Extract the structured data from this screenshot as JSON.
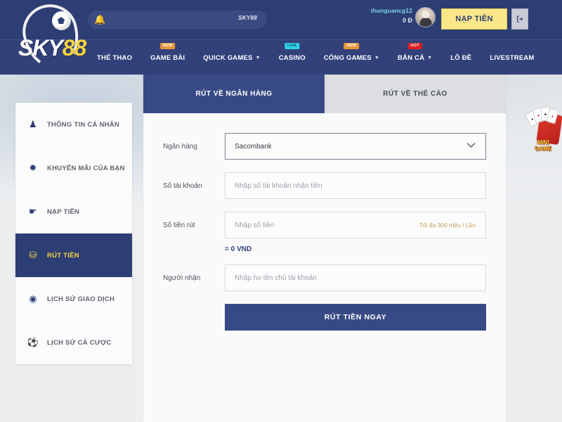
{
  "brand": {
    "logo_primary": "SKY",
    "logo_accent": "88",
    "logo_ball_icon": "soccer-ball-icon"
  },
  "topbar": {
    "marquee": {
      "icon": "bell-notification-icon",
      "text": "SKY88"
    },
    "user": {
      "username": "thunguancg12",
      "balance": "0 Ð",
      "avatar_icon": "user-avatar-icon"
    },
    "deposit_label": "NẠP TIỀN",
    "logout_icon": "logout-icon",
    "colors": {
      "header_bg": "#2c3e73",
      "nav_bg": "#33417a",
      "deposit_bg": "#fbe78a",
      "accent_gold": "#f5d340"
    }
  },
  "nav": {
    "items": [
      {
        "label": "THỂ THAO",
        "badge": null,
        "badge_type": null,
        "caret": false
      },
      {
        "label": "GAME BÀI",
        "badge": "NEW",
        "badge_type": "new",
        "caret": false
      },
      {
        "label": "QUICK GAMES",
        "badge": null,
        "badge_type": null,
        "caret": true
      },
      {
        "label": "CASINO",
        "badge": "LIVE",
        "badge_type": "live",
        "caret": false
      },
      {
        "label": "CỔNG GAMES",
        "badge": "NEW",
        "badge_type": "new",
        "caret": true
      },
      {
        "label": "BẮN CÁ",
        "badge": "HOT",
        "badge_type": "hot",
        "caret": true
      },
      {
        "label": "LÔ ĐỀ",
        "badge": null,
        "badge_type": null,
        "caret": false
      },
      {
        "label": "LIVESTREAM",
        "badge": null,
        "badge_type": null,
        "caret": false
      }
    ]
  },
  "sidebar": {
    "items": [
      {
        "label": "THÔNG TIN CÁ NHÂN",
        "icon": "user-icon",
        "glyph": "♟",
        "active": false
      },
      {
        "label": "KHUYẾN MÃI CỦA BẠN",
        "icon": "gift-promo-icon",
        "glyph": "✹",
        "active": false
      },
      {
        "label": "NẠP TIỀN",
        "icon": "deposit-hand-icon",
        "glyph": "☛",
        "active": false
      },
      {
        "label": "RÚT TIỀN",
        "icon": "withdraw-coin-icon",
        "glyph": "⛁",
        "active": true
      },
      {
        "label": "LỊCH SỬ GIAO DỊCH",
        "icon": "clock-history-icon",
        "glyph": "◉",
        "active": false
      },
      {
        "label": "LỊCH SỬ CÁ CƯỢC",
        "icon": "soccer-ball-icon",
        "glyph": "⚽",
        "active": false
      }
    ]
  },
  "content": {
    "tabs": [
      {
        "label": "RÚT VỀ NGÂN HÀNG",
        "active": true
      },
      {
        "label": "RÚT VỀ THẺ CÀO",
        "active": false
      }
    ],
    "form": {
      "bank": {
        "label": "Ngân hàng",
        "value": "Sacombank",
        "caret_icon": "chevron-down-icon"
      },
      "account_number": {
        "label": "Số tài khoản",
        "value": "",
        "placeholder": "Nhập số tài khoản nhận tiền"
      },
      "amount": {
        "label": "Số tiền rút",
        "value": "",
        "placeholder": "Nhập số tiền",
        "hint": "Tối đa 300 triệu / Lần"
      },
      "converted": "= 0 VND",
      "receiver": {
        "label": "Người nhận",
        "value": "",
        "placeholder": "Nhập họ tên chủ tài khoản"
      },
      "submit_label": "RÚT TIỀN NGAY"
    }
  },
  "minigame": {
    "label_line1": "MINI",
    "label_line2": "GAME",
    "icon": "playing-cards-icon",
    "cards": [
      "♠",
      "♥",
      "♣",
      "♦"
    ]
  }
}
